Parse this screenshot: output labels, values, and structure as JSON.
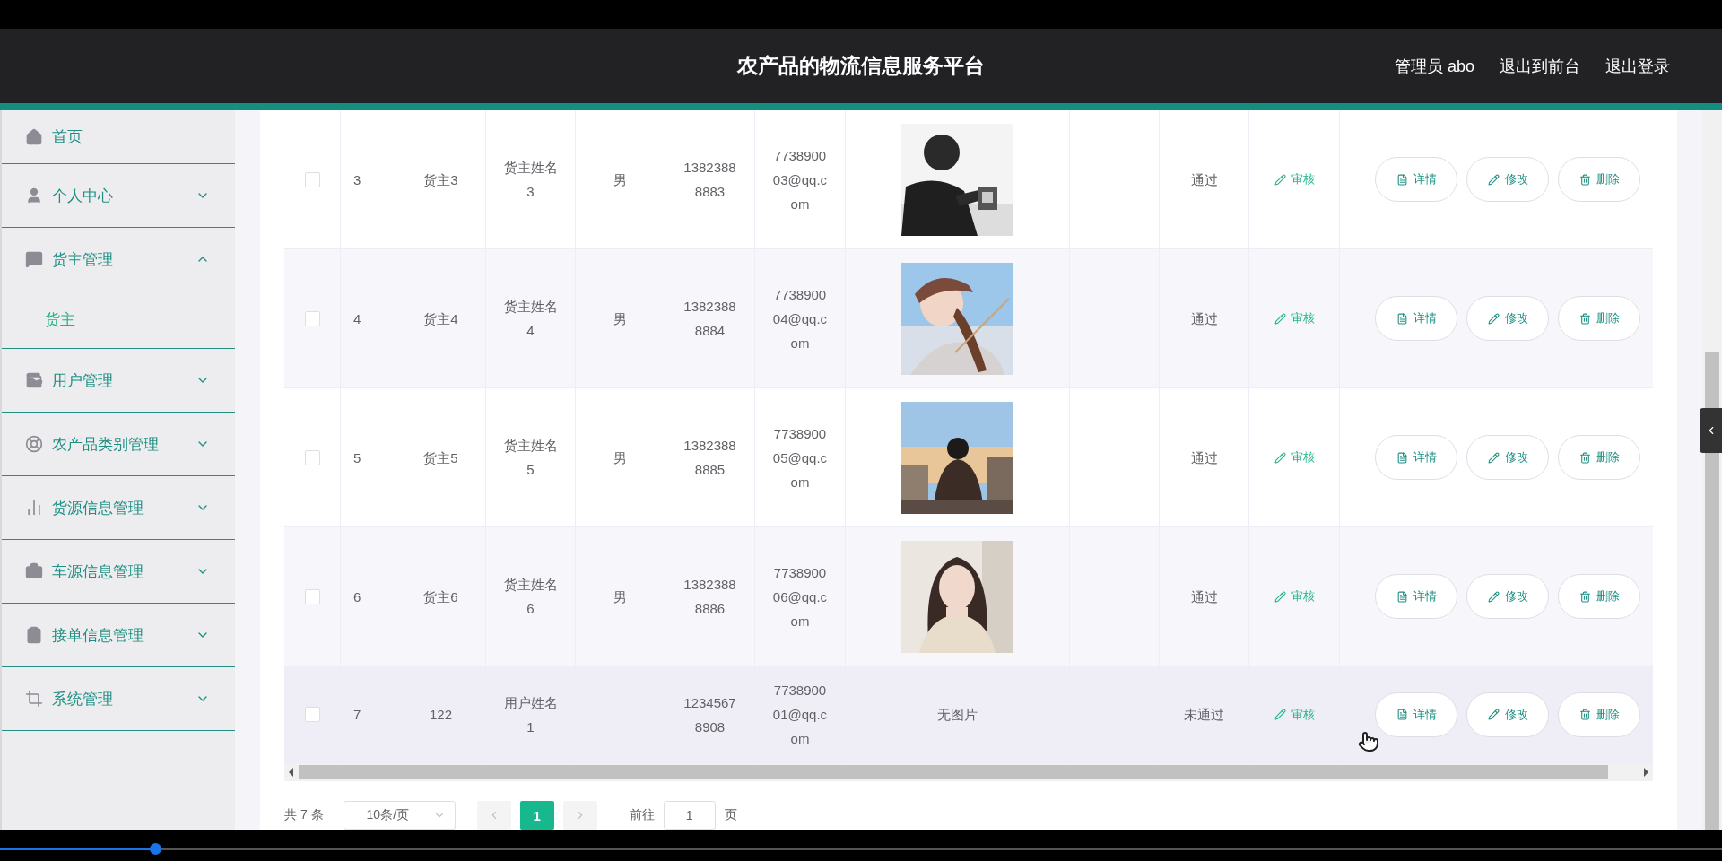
{
  "header": {
    "title": "农产品的物流信息服务平台",
    "user": "管理员 abo",
    "links": [
      "退出到前台",
      "退出登录"
    ]
  },
  "sidebar": {
    "items": [
      {
        "label": "首页"
      },
      {
        "label": "个人中心",
        "expanded": false
      },
      {
        "label": "货主管理",
        "expanded": true,
        "children": [
          {
            "label": "货主",
            "selected": true
          }
        ]
      },
      {
        "label": "用户管理",
        "expanded": false
      },
      {
        "label": "农产品类别管理",
        "expanded": false
      },
      {
        "label": "货源信息管理",
        "expanded": false
      },
      {
        "label": "车源信息管理",
        "expanded": false
      },
      {
        "label": "接单信息管理",
        "expanded": false
      },
      {
        "label": "系统管理",
        "expanded": false
      }
    ]
  },
  "table": {
    "rows": [
      {
        "checked": false,
        "index": "3",
        "account": "货主3",
        "name": "货主姓名3",
        "gender": "男",
        "phone": "13823888883",
        "email": "773890003@qq.com",
        "status": "通过",
        "review": "审核",
        "actions": [
          "详情",
          "修改",
          "删除"
        ]
      },
      {
        "checked": false,
        "index": "4",
        "account": "货主4",
        "name": "货主姓名4",
        "gender": "男",
        "phone": "13823888884",
        "email": "773890004@qq.com",
        "status": "通过",
        "review": "审核",
        "actions": [
          "详情",
          "修改",
          "删除"
        ]
      },
      {
        "checked": false,
        "index": "5",
        "account": "货主5",
        "name": "货主姓名5",
        "gender": "男",
        "phone": "13823888885",
        "email": "773890005@qq.com",
        "status": "通过",
        "review": "审核",
        "actions": [
          "详情",
          "修改",
          "删除"
        ]
      },
      {
        "checked": false,
        "index": "6",
        "account": "货主6",
        "name": "货主姓名6",
        "gender": "男",
        "phone": "13823888886",
        "email": "773890006@qq.com",
        "status": "通过",
        "review": "审核",
        "actions": [
          "详情",
          "修改",
          "删除"
        ]
      },
      {
        "checked": false,
        "hovered": true,
        "index": "7",
        "account": "122",
        "name": "用户姓名1",
        "phone": "12345678908",
        "email": "773890001@qq.com",
        "photo_text": "无图片",
        "status": "未通过",
        "review": "审核",
        "actions": [
          "详情",
          "修改",
          "删除"
        ]
      }
    ]
  },
  "pagination": {
    "total": "共 7 条",
    "page_size": "10条/页",
    "pages": [
      {
        "label": "1",
        "selected": true
      }
    ],
    "goto_label": "前往",
    "goto_value": "1",
    "goto_suffix": "页"
  },
  "player": {
    "level": 0.09
  }
}
